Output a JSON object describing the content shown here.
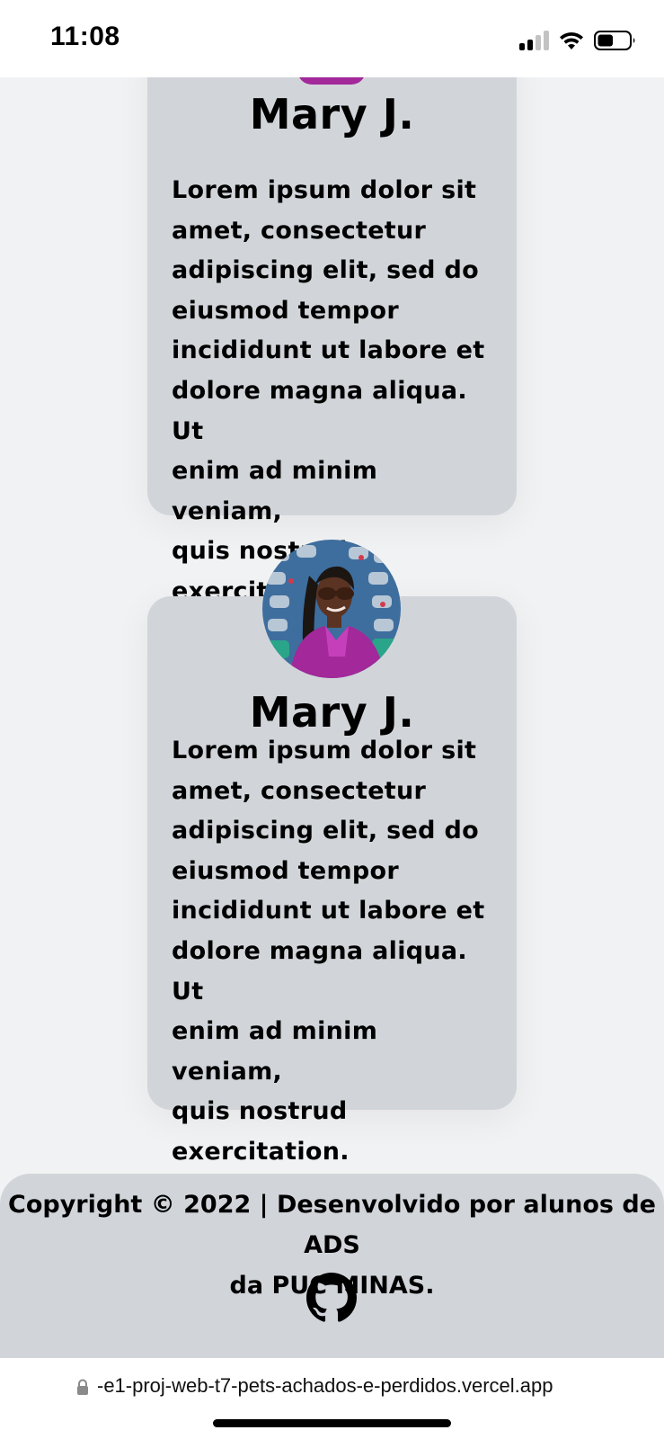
{
  "status_bar": {
    "time": "11:08",
    "battery_level": 0.5
  },
  "cards": [
    {
      "name": "Mary J.",
      "lines": [
        "Lorem ipsum dolor sit",
        "amet, consectetur",
        "adipiscing elit, sed do",
        "eiusmod tempor",
        "incididunt ut labore et",
        "dolore magna aliqua. Ut",
        "enim ad minim veniam,",
        "quis nostrud",
        "exercitation."
      ]
    },
    {
      "name": "Mary J.",
      "lines": [
        "Lorem ipsum dolor sit",
        "amet, consectetur",
        "adipiscing elit, sed do",
        "eiusmod tempor",
        "incididunt ut labore et",
        "dolore magna aliqua. Ut",
        "enim ad minim veniam,",
        "quis nostrud",
        "exercitation."
      ]
    }
  ],
  "footer": {
    "line1": "Copyright © 2022 | Desenvolvido por alunos de ADS",
    "line2": "da PUC MINAS.",
    "icon": "github-icon"
  },
  "browser": {
    "url": "-e1-proj-web-t7-pets-achados-e-perdidos.vercel.app"
  },
  "colors": {
    "card_bg": "#d1d5da",
    "page_bg": "#f1f2f3",
    "accent_magenta": "#a3289a"
  }
}
